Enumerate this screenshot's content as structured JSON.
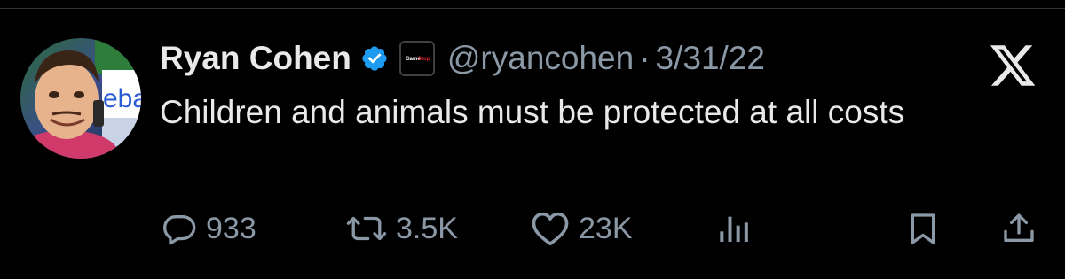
{
  "tweet": {
    "author_name": "Ryan Cohen",
    "handle": "@ryancohen",
    "separator": "·",
    "date": "3/31/22",
    "text": "Children and animals must be protected at all costs",
    "affiliate_badge_text": "GameStop"
  },
  "stats": {
    "replies": "933",
    "retweets": "3.5K",
    "likes": "23K"
  },
  "colors": {
    "background": "#000000",
    "primary_text": "#e7e9ea",
    "secondary_text": "#8b98a5",
    "verified_badge": "#1d9bf0"
  },
  "icons": {
    "verified": "verified-badge-icon",
    "affiliate": "gamestop-affiliate-icon",
    "platform": "x-logo-icon",
    "reply": "reply-icon",
    "retweet": "retweet-icon",
    "like": "like-icon",
    "views": "views-icon",
    "bookmark": "bookmark-icon",
    "share": "share-icon"
  }
}
